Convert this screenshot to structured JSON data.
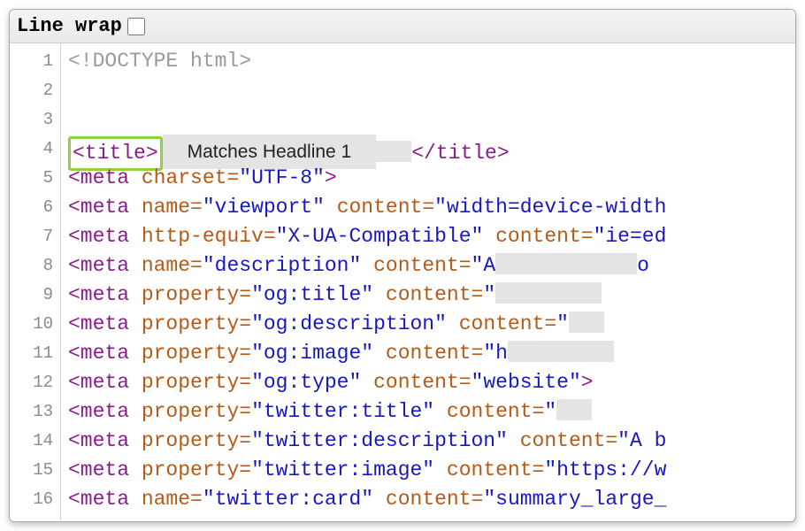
{
  "toolbar": {
    "linewrap_label": "Line wrap",
    "linewrap_checked": false
  },
  "annotation": {
    "label": "Matches Headline 1"
  },
  "gutter_start": 1,
  "gutter_end": 16,
  "code_lines": [
    {
      "n": 1,
      "tokens": [
        {
          "t": "<!DOCTYPE html>",
          "cls": "c-comment"
        }
      ]
    },
    {
      "n": 2,
      "tokens": []
    },
    {
      "n": 3,
      "tokens": []
    },
    {
      "n": 4,
      "special": "title_line",
      "open_tag": "<title>",
      "close_tag": "</title>"
    },
    {
      "n": 5,
      "tokens": [
        {
          "t": "<meta ",
          "cls": "c-tag"
        },
        {
          "t": "charset",
          "cls": "c-attr"
        },
        {
          "t": "=",
          "cls": "c-punct"
        },
        {
          "t": "\"UTF-8\"",
          "cls": "c-string"
        },
        {
          "t": ">",
          "cls": "c-tag"
        }
      ]
    },
    {
      "n": 6,
      "tokens": [
        {
          "t": "<meta ",
          "cls": "c-tag"
        },
        {
          "t": "name",
          "cls": "c-attr"
        },
        {
          "t": "=",
          "cls": "c-punct"
        },
        {
          "t": "\"viewport\"",
          "cls": "c-string"
        },
        {
          "t": " ",
          "cls": ""
        },
        {
          "t": "content",
          "cls": "c-attr"
        },
        {
          "t": "=",
          "cls": "c-punct"
        },
        {
          "t": "\"width=device-width",
          "cls": "c-string"
        }
      ]
    },
    {
      "n": 7,
      "tokens": [
        {
          "t": "<meta ",
          "cls": "c-tag"
        },
        {
          "t": "http-equiv",
          "cls": "c-attr"
        },
        {
          "t": "=",
          "cls": "c-punct"
        },
        {
          "t": "\"X-UA-Compatible\"",
          "cls": "c-string"
        },
        {
          "t": " ",
          "cls": ""
        },
        {
          "t": "content",
          "cls": "c-attr"
        },
        {
          "t": "=",
          "cls": "c-punct"
        },
        {
          "t": "\"ie=ed",
          "cls": "c-string"
        }
      ]
    },
    {
      "n": 8,
      "tokens": [
        {
          "t": "<meta ",
          "cls": "c-tag"
        },
        {
          "t": "name",
          "cls": "c-attr"
        },
        {
          "t": "=",
          "cls": "c-punct"
        },
        {
          "t": "\"description\"",
          "cls": "c-string"
        },
        {
          "t": " ",
          "cls": ""
        },
        {
          "t": "content",
          "cls": "c-attr"
        },
        {
          "t": "=",
          "cls": "c-punct"
        },
        {
          "t": "\"A",
          "cls": "c-string"
        },
        {
          "grey": 160
        },
        {
          "t": "o",
          "cls": "c-string"
        }
      ]
    },
    {
      "n": 9,
      "tokens": [
        {
          "t": "<meta ",
          "cls": "c-tag"
        },
        {
          "t": "property",
          "cls": "c-attr"
        },
        {
          "t": "=",
          "cls": "c-punct"
        },
        {
          "t": "\"og:title\"",
          "cls": "c-string"
        },
        {
          "t": " ",
          "cls": ""
        },
        {
          "t": "content",
          "cls": "c-attr"
        },
        {
          "t": "=",
          "cls": "c-punct"
        },
        {
          "t": "\"",
          "cls": "c-string"
        },
        {
          "grey": 120
        }
      ]
    },
    {
      "n": 10,
      "tokens": [
        {
          "t": "<meta ",
          "cls": "c-tag"
        },
        {
          "t": "property",
          "cls": "c-attr"
        },
        {
          "t": "=",
          "cls": "c-punct"
        },
        {
          "t": "\"og:description\"",
          "cls": "c-string"
        },
        {
          "t": " ",
          "cls": ""
        },
        {
          "t": "content",
          "cls": "c-attr"
        },
        {
          "t": "=",
          "cls": "c-punct"
        },
        {
          "t": "\"",
          "cls": "c-string"
        },
        {
          "grey": 40
        }
      ]
    },
    {
      "n": 11,
      "tokens": [
        {
          "t": "<meta ",
          "cls": "c-tag"
        },
        {
          "t": "property",
          "cls": "c-attr"
        },
        {
          "t": "=",
          "cls": "c-punct"
        },
        {
          "t": "\"og:image\"",
          "cls": "c-string"
        },
        {
          "t": " ",
          "cls": ""
        },
        {
          "t": "content",
          "cls": "c-attr"
        },
        {
          "t": "=",
          "cls": "c-punct"
        },
        {
          "t": "\"h",
          "cls": "c-string"
        },
        {
          "grey": 120
        }
      ]
    },
    {
      "n": 12,
      "tokens": [
        {
          "t": "<meta ",
          "cls": "c-tag"
        },
        {
          "t": "property",
          "cls": "c-attr"
        },
        {
          "t": "=",
          "cls": "c-punct"
        },
        {
          "t": "\"og:type\"",
          "cls": "c-string"
        },
        {
          "t": " ",
          "cls": ""
        },
        {
          "t": "content",
          "cls": "c-attr"
        },
        {
          "t": "=",
          "cls": "c-punct"
        },
        {
          "t": "\"website\"",
          "cls": "c-string"
        },
        {
          "t": ">",
          "cls": "c-tag"
        }
      ]
    },
    {
      "n": 13,
      "tokens": [
        {
          "t": "<meta ",
          "cls": "c-tag"
        },
        {
          "t": "property",
          "cls": "c-attr"
        },
        {
          "t": "=",
          "cls": "c-punct"
        },
        {
          "t": "\"twitter:title\"",
          "cls": "c-string"
        },
        {
          "t": " ",
          "cls": ""
        },
        {
          "t": "content",
          "cls": "c-attr"
        },
        {
          "t": "=",
          "cls": "c-punct"
        },
        {
          "t": "\"",
          "cls": "c-string"
        },
        {
          "grey": 40
        }
      ]
    },
    {
      "n": 14,
      "tokens": [
        {
          "t": "<meta ",
          "cls": "c-tag"
        },
        {
          "t": "property",
          "cls": "c-attr"
        },
        {
          "t": "=",
          "cls": "c-punct"
        },
        {
          "t": "\"twitter:description\"",
          "cls": "c-string"
        },
        {
          "t": " ",
          "cls": ""
        },
        {
          "t": "content",
          "cls": "c-attr"
        },
        {
          "t": "=",
          "cls": "c-punct"
        },
        {
          "t": "\"A b",
          "cls": "c-string"
        }
      ]
    },
    {
      "n": 15,
      "tokens": [
        {
          "t": "<meta ",
          "cls": "c-tag"
        },
        {
          "t": "property",
          "cls": "c-attr"
        },
        {
          "t": "=",
          "cls": "c-punct"
        },
        {
          "t": "\"twitter:image\"",
          "cls": "c-string"
        },
        {
          "t": " ",
          "cls": ""
        },
        {
          "t": "content",
          "cls": "c-attr"
        },
        {
          "t": "=",
          "cls": "c-punct"
        },
        {
          "t": "\"https://w",
          "cls": "c-string"
        }
      ]
    },
    {
      "n": 16,
      "tokens": [
        {
          "t": "<meta ",
          "cls": "c-tag"
        },
        {
          "t": "name",
          "cls": "c-attr"
        },
        {
          "t": "=",
          "cls": "c-punct"
        },
        {
          "t": "\"twitter:card\"",
          "cls": "c-string"
        },
        {
          "t": " ",
          "cls": ""
        },
        {
          "t": "content",
          "cls": "c-attr"
        },
        {
          "t": "=",
          "cls": "c-punct"
        },
        {
          "t": "\"summary_large_",
          "cls": "c-string"
        }
      ]
    }
  ]
}
